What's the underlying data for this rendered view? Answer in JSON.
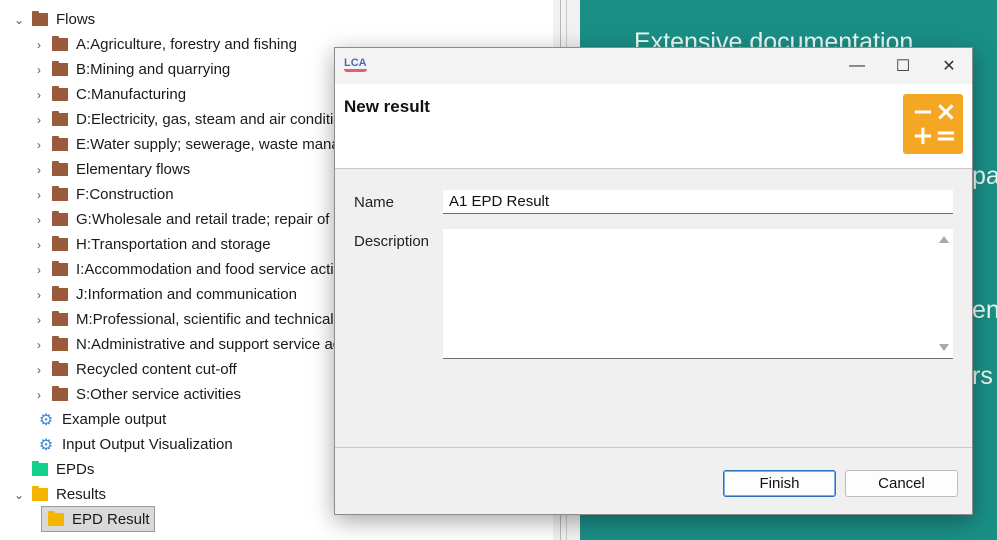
{
  "tree": {
    "flows_label": "Flows",
    "categories": [
      "A:Agriculture, forestry and fishing",
      "B:Mining and quarrying",
      "C:Manufacturing",
      "D:Electricity, gas, steam and air conditio",
      "E:Water supply; sewerage, waste manag",
      "Elementary flows",
      "F:Construction",
      "G:Wholesale and retail trade; repair of m",
      "H:Transportation and storage",
      "I:Accommodation and food service activ",
      "J:Information and communication",
      "M:Professional, scientific and technical a",
      "N:Administrative and support service ac",
      "Recycled content cut-off",
      "S:Other service activities"
    ],
    "example_output": "Example output",
    "io_visualization": "Input Output Visualization",
    "epds": "EPDs",
    "results": "Results",
    "epd_result": "EPD Result"
  },
  "background": {
    "line1": "Extensive documentation",
    "frag2": "pa",
    "frag3": "en",
    "frag4": "rs"
  },
  "dialog": {
    "app_logo": "LCA",
    "title": "New result",
    "name_label": "Name",
    "name_value": "A1 EPD Result",
    "description_label": "Description",
    "description_value": "",
    "finish_label": "Finish",
    "cancel_label": "Cancel",
    "minimize_glyph": "—",
    "maximize_glyph": "☐",
    "close_glyph": "✕",
    "icon": "calculator-icon",
    "icon_color": "#f5a623"
  }
}
